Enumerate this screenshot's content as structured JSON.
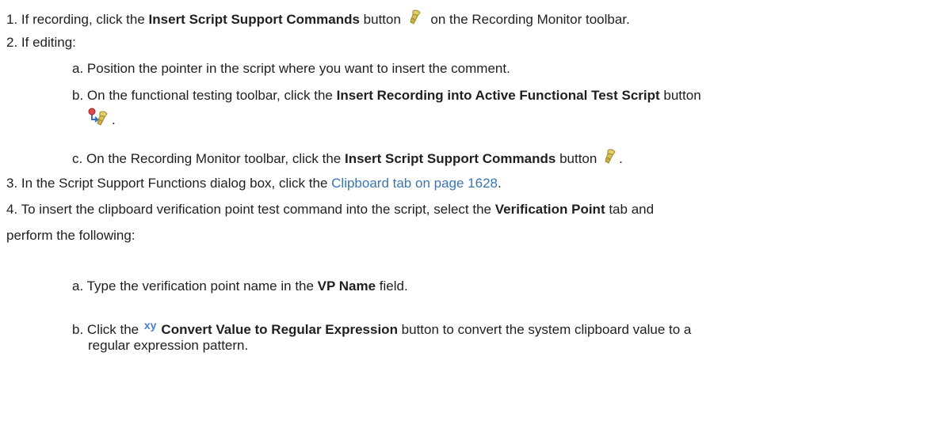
{
  "steps": [
    {
      "num": "1.",
      "pre": "If recording, click the ",
      "bold": "Insert Script Support Commands",
      "post": " on the Recording Monitor toolbar.",
      "btn_word": "button",
      "icon": "script-support-icon"
    },
    {
      "num": "2.",
      "text": "If editing:",
      "sub": [
        {
          "letter": "a.",
          "text": "Position the pointer in the script where you want to insert the comment."
        },
        {
          "letter": "b.",
          "pre": "On the functional testing toolbar, click the ",
          "bold": "Insert Recording into Active Functional Test Script",
          "post": " button",
          "tail": ".",
          "icon": "insert-recording-icon"
        },
        {
          "letter": "c.",
          "pre": "On the Recording Monitor toolbar, click the ",
          "bold": "Insert Script Support Commands",
          "post": " button",
          "tail": ".",
          "icon": "script-support-icon"
        }
      ]
    },
    {
      "num": "3.",
      "pre": "In the Script Support Functions dialog box, click the ",
      "link": "Clipboard tab on page 1628",
      "post": "."
    },
    {
      "num": "4.",
      "pre": "To insert the clipboard verification point test command into the script, select the ",
      "bold": "Verification Point",
      "post": " tab and",
      "cont": "perform the following:",
      "sub": [
        {
          "letter": "a.",
          "pre": "Type the verification point name in the ",
          "bold": "VP Name",
          "post": " field."
        },
        {
          "letter": "b.",
          "pre": "Click the ",
          "icon_text": "xy",
          "bold": "Convert Value to Regular Expression",
          "post": " button to convert the system clipboard value to a",
          "cont": "regular expression pattern.",
          "icon": "convert-regex-icon"
        }
      ]
    }
  ],
  "colors": {
    "link": "#3a76b5",
    "text": "#1f1f1f",
    "regex_icon": "#4a7fd0"
  }
}
